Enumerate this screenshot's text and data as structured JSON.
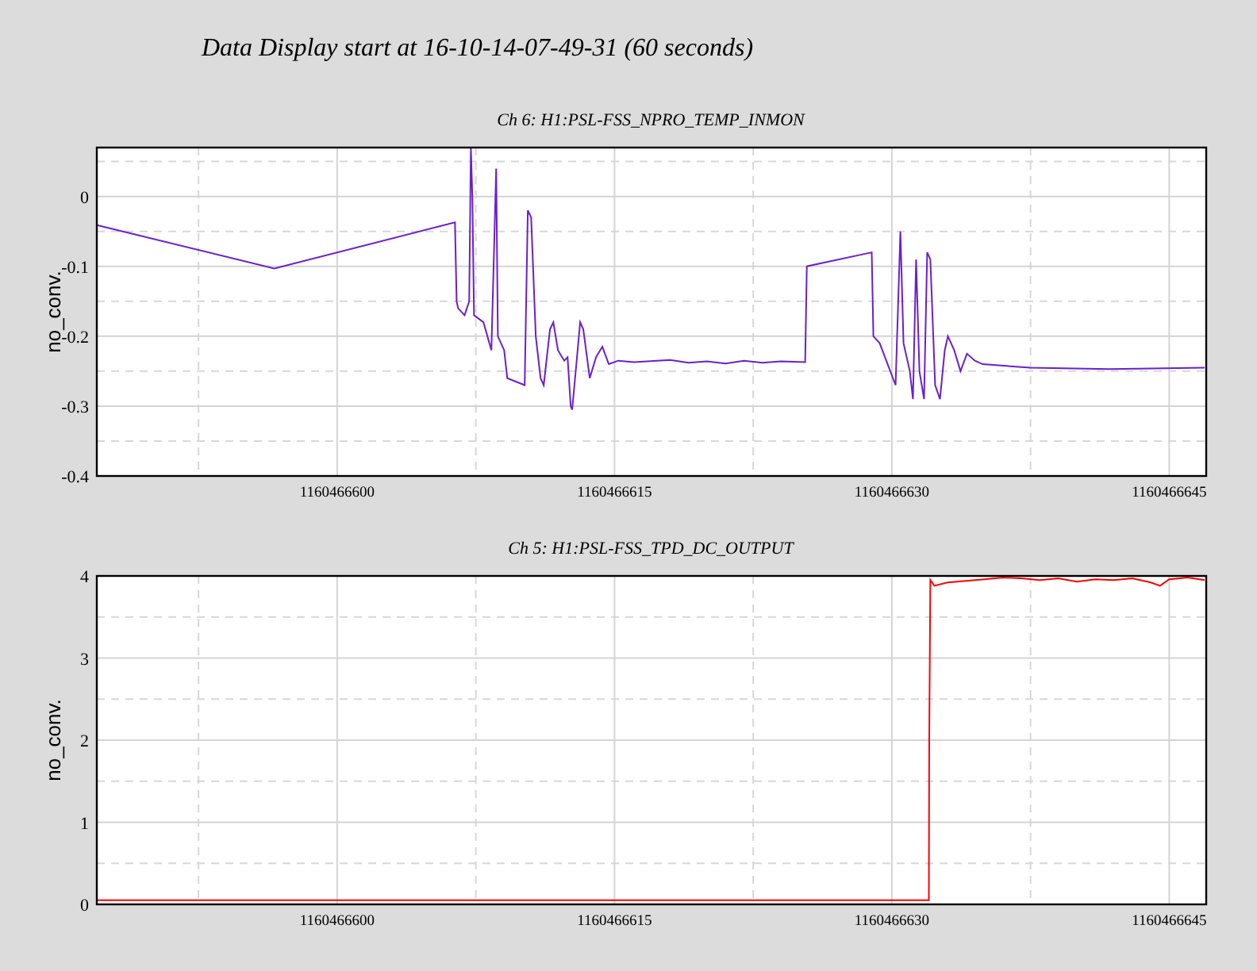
{
  "title": "Data Display start at 16-10-14-07-49-31 (60 seconds)",
  "panels": [
    {
      "chart_data": {
        "type": "line",
        "title": "Ch 6: H1:PSL-FSS_NPRO_TEMP_INMON",
        "ylabel": "no_conv.",
        "xlim": [
          1160466587,
          1160466647
        ],
        "ylim": [
          -0.4,
          0.07
        ],
        "xticks": [
          1160466600,
          1160466615,
          1160466630,
          1160466645
        ],
        "yticks": [
          -0.4,
          -0.3,
          -0.2,
          -0.1,
          0
        ],
        "x": [
          1160466587,
          1160466596.6,
          1160466606.37,
          1160466606.46,
          1160466606.54,
          1160466606.89,
          1160466607.14,
          1160466607.23,
          1160466607.31,
          1160466607.4,
          1160466607.91,
          1160466608.34,
          1160466608.6,
          1160466608.69,
          1160466608.86,
          1160466609.03,
          1160466609.2,
          1160466610.14,
          1160466610.31,
          1160466610.49,
          1160466610.74,
          1160466611,
          1160466611.17,
          1160466611.51,
          1160466611.69,
          1160466611.94,
          1160466612.28,
          1160466612.46,
          1160466612.63,
          1160466612.71,
          1160466612.97,
          1160466613.14,
          1160466613.31,
          1160466613.66,
          1160466614,
          1160466614.34,
          1160466614.69,
          1160466615.2,
          1160466616.06,
          1160466618,
          1160466619,
          1160466620,
          1160466621,
          1160466622,
          1160466623,
          1160466624,
          1160466625.31,
          1160466625.4,
          1160466628.91,
          1160466629,
          1160466629.34,
          1160466630.2,
          1160466630.46,
          1160466630.63,
          1160466630.97,
          1160466631.14,
          1160466631.31,
          1160466631.49,
          1160466631.74,
          1160466631.91,
          1160466632.08,
          1160466632.34,
          1160466632.6,
          1160466632.86,
          1160466633.03,
          1160466633.37,
          1160466633.71,
          1160466634.06,
          1160466634.49,
          1160466634.91,
          1160466637.48,
          1160466641.77,
          1160466646.91
        ],
        "grid": true,
        "series": [
          {
            "color": "#6a1fd0",
            "values": [
              -0.041,
              -0.103,
              -0.037,
              -0.15,
              -0.16,
              -0.17,
              -0.15,
              0.07,
              0.0,
              -0.17,
              -0.18,
              -0.22,
              0.04,
              -0.2,
              -0.21,
              -0.22,
              -0.26,
              -0.27,
              -0.02,
              -0.03,
              -0.2,
              -0.26,
              -0.27,
              -0.19,
              -0.18,
              -0.22,
              -0.235,
              -0.23,
              -0.3,
              -0.305,
              -0.23,
              -0.18,
              -0.19,
              -0.26,
              -0.23,
              -0.215,
              -0.24,
              -0.235,
              -0.237,
              -0.234,
              -0.238,
              -0.236,
              -0.239,
              -0.235,
              -0.238,
              -0.236,
              -0.237,
              -0.1,
              -0.08,
              -0.2,
              -0.21,
              -0.27,
              -0.05,
              -0.21,
              -0.25,
              -0.29,
              -0.09,
              -0.25,
              -0.29,
              -0.08,
              -0.09,
              -0.27,
              -0.29,
              -0.22,
              -0.2,
              -0.22,
              -0.25,
              -0.225,
              -0.235,
              -0.24,
              -0.245,
              -0.247,
              -0.245
            ]
          }
        ]
      }
    },
    {
      "chart_data": {
        "type": "line",
        "title": "Ch 5: H1:PSL-FSS_TPD_DC_OUTPUT",
        "ylabel": "no_conv.",
        "xlim": [
          1160466587,
          1160466647
        ],
        "ylim": [
          0,
          4
        ],
        "xticks": [
          1160466600,
          1160466615,
          1160466630,
          1160466645
        ],
        "yticks": [
          0,
          1,
          2,
          3,
          4
        ],
        "x": [
          1160466587,
          1160466632,
          1160466632.02,
          1160466632.08,
          1160466632.3,
          1160466633,
          1160466634,
          1160466635,
          1160466636,
          1160466637,
          1160466638,
          1160466639,
          1160466640,
          1160466641,
          1160466642,
          1160466643,
          1160466644,
          1160466644.5,
          1160466645,
          1160466646,
          1160466646.91
        ],
        "grid": true,
        "series": [
          {
            "color": "#ff0000",
            "values": [
              0.05,
              0.05,
              2.0,
              3.95,
              3.88,
              3.92,
              3.94,
              3.96,
              3.98,
              3.97,
              3.95,
              3.97,
              3.93,
              3.96,
              3.95,
              3.97,
              3.92,
              3.88,
              3.96,
              3.98,
              3.95
            ]
          }
        ]
      }
    }
  ]
}
